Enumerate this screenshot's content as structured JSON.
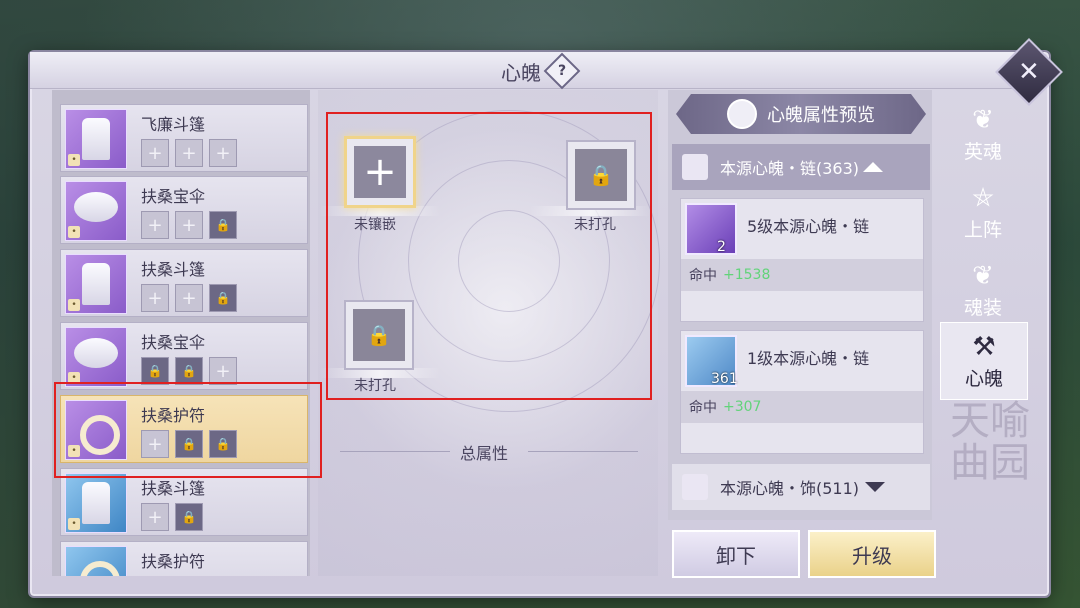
{
  "title": "心魄",
  "help_glyph": "?",
  "close_glyph": "✕",
  "items": [
    {
      "name": "飞廉斗篷",
      "icon": "cloak-icon",
      "rarity": "purple",
      "slots": [
        "empty",
        "empty",
        "empty"
      ]
    },
    {
      "name": "扶桑宝伞",
      "icon": "umbrella-icon",
      "rarity": "purple",
      "slots": [
        "empty",
        "empty",
        "locked"
      ]
    },
    {
      "name": "扶桑斗篷",
      "icon": "cloak-icon",
      "rarity": "purple",
      "slots": [
        "empty",
        "empty",
        "locked"
      ]
    },
    {
      "name": "扶桑宝伞",
      "icon": "umbrella-icon",
      "rarity": "purple",
      "slots": [
        "locked",
        "locked",
        "empty"
      ]
    },
    {
      "name": "扶桑护符",
      "icon": "amulet-icon",
      "rarity": "purple",
      "slots": [
        "empty",
        "locked",
        "locked"
      ],
      "selected": true
    },
    {
      "name": "扶桑斗篷",
      "icon": "cloak-icon",
      "rarity": "blue",
      "slots": [
        "empty",
        "locked"
      ]
    },
    {
      "name": "扶桑护符",
      "icon": "amulet-icon",
      "rarity": "blue",
      "slots": []
    }
  ],
  "sockets": [
    {
      "label": "未镶嵌",
      "state": "active",
      "glyph": "+"
    },
    {
      "label": "未打孔",
      "state": "locked",
      "glyph": "🔒"
    },
    {
      "label": "未打孔",
      "state": "locked",
      "glyph": "🔒"
    }
  ],
  "total_attributes_label": "总属性",
  "preview": {
    "header": "心魄属性预览",
    "groups": [
      {
        "label": "本源心魄・链(363)",
        "expanded": true
      },
      {
        "label": "本源心魄・饰(511)",
        "expanded": false
      }
    ],
    "souls": [
      {
        "name": "5级本源心魄・链",
        "count": "2",
        "stat_label": "命中",
        "stat_value": "+1538",
        "color": "purple"
      },
      {
        "name": "1级本源心魄・链",
        "count": "361",
        "stat_label": "命中",
        "stat_value": "+307",
        "color": "blue"
      }
    ]
  },
  "buttons": {
    "unload": "卸下",
    "upgrade": "升级"
  },
  "tabs": [
    {
      "label": "英魂",
      "icon": "flame-icon",
      "glyph": "❦"
    },
    {
      "label": "上阵",
      "icon": "pentagram-icon",
      "glyph": "⛤"
    },
    {
      "label": "魂装",
      "icon": "soul-armor-icon",
      "glyph": "❦"
    },
    {
      "label": "心魄",
      "icon": "hammer-icon",
      "glyph": "⚒",
      "active": true
    }
  ],
  "watermark": "天喻曲园"
}
